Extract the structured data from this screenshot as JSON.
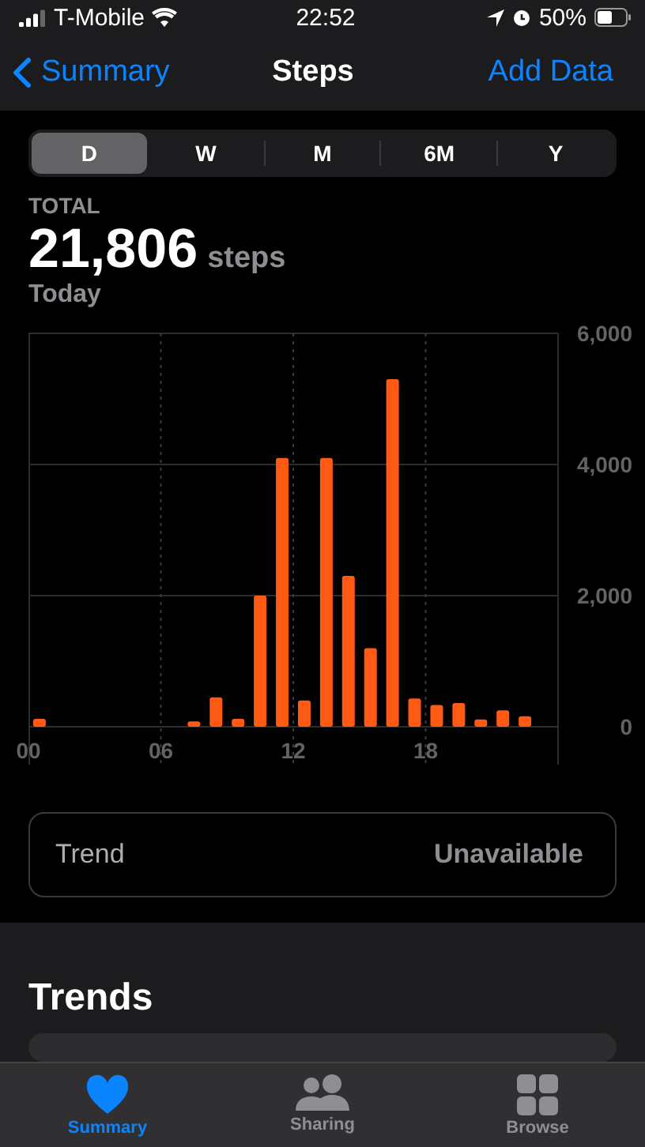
{
  "status_bar": {
    "carrier": "T-Mobile",
    "time": "22:52",
    "battery": "50%"
  },
  "nav": {
    "back": "Summary",
    "title": "Steps",
    "action": "Add Data"
  },
  "segments": [
    {
      "label": "D",
      "selected": true
    },
    {
      "label": "W",
      "selected": false
    },
    {
      "label": "M",
      "selected": false
    },
    {
      "label": "6M",
      "selected": false
    },
    {
      "label": "Y",
      "selected": false
    }
  ],
  "summary": {
    "label": "TOTAL",
    "value": "21,806",
    "unit": "steps",
    "period": "Today"
  },
  "chart": {
    "chart_data": {
      "type": "bar",
      "x": [
        0.5,
        1.5,
        2.5,
        3.5,
        4.5,
        5.5,
        6.5,
        7.5,
        8.5,
        9.5,
        10.5,
        11.5,
        12.5,
        13.5,
        14.5,
        15.5,
        16.5,
        17.5,
        18.5,
        19.5,
        20.5,
        21.5,
        22.5,
        23.5
      ],
      "xlim": [
        0,
        24
      ],
      "grid": true,
      "series": [
        {
          "color": "#ff5a14",
          "values": [
            120,
            0,
            0,
            0,
            0,
            0,
            0,
            80,
            450,
            120,
            2000,
            4100,
            400,
            4100,
            2300,
            1200,
            5300,
            430,
            330,
            360,
            110,
            250,
            160,
            0
          ]
        }
      ],
      "ylim": [
        0,
        6000
      ],
      "yticks": [
        {
          "value": 0,
          "label": "0"
        },
        {
          "value": 2000,
          "label": "2,000"
        },
        {
          "value": 4000,
          "label": "4,000"
        },
        {
          "value": 6000,
          "label": "6,000"
        }
      ],
      "xticks": [
        {
          "value": 0,
          "label": "00"
        },
        {
          "value": 6,
          "label": "06"
        },
        {
          "value": 12,
          "label": "12"
        },
        {
          "value": 18,
          "label": "18"
        }
      ]
    }
  },
  "trend": {
    "label": "Trend",
    "value": "Unavailable"
  },
  "trends_section": {
    "title": "Trends"
  },
  "tab_bar": [
    {
      "kind": "heart",
      "label": "Summary",
      "selected": true
    },
    {
      "kind": "people",
      "label": "Sharing",
      "selected": false
    },
    {
      "kind": "grid",
      "label": "Browse",
      "selected": false
    }
  ]
}
